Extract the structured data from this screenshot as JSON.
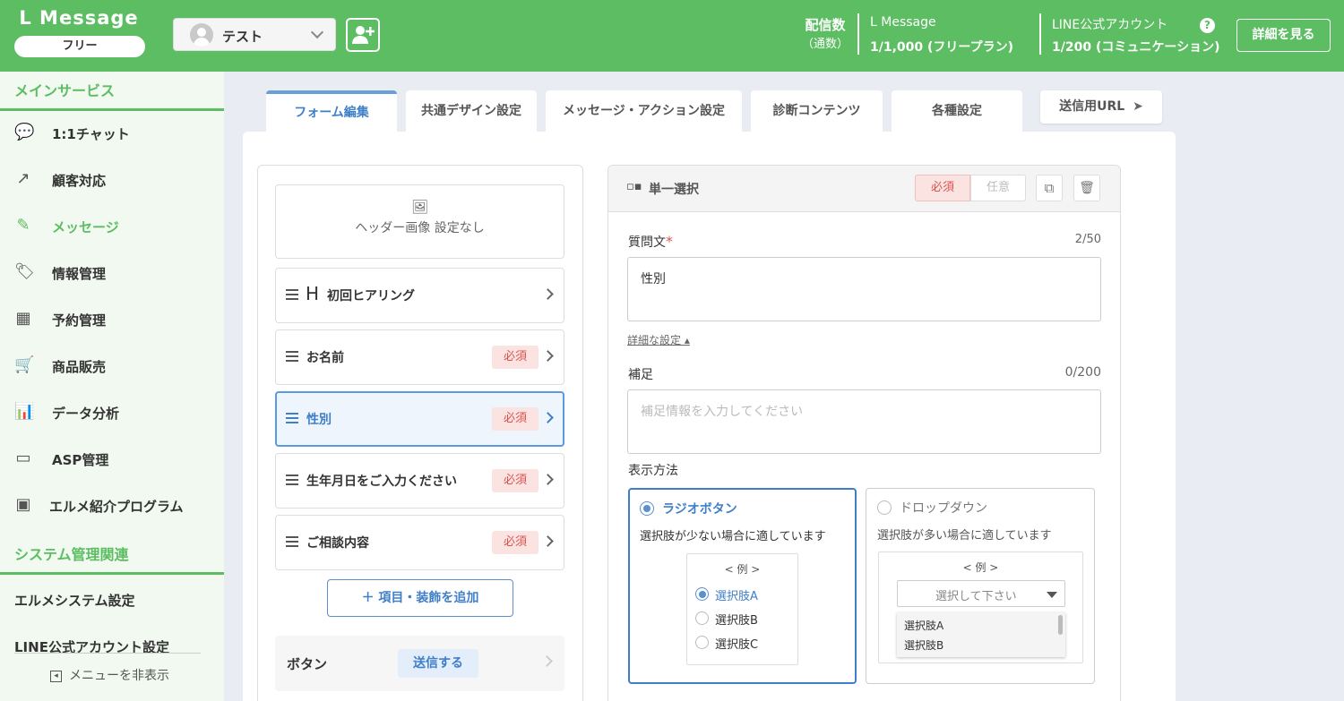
{
  "topbar": {
    "brand": "L Message",
    "plan_pill": "フリー",
    "account_name": "テスト",
    "stat_label_line1": "配信数",
    "stat_label_line2": "（通数）",
    "lmessage_caption": "L Message",
    "lmessage_value": "1/1,000 (フリープラン)",
    "line_caption": "LINE公式アカウント",
    "line_value": "1/200 (コミュニケーション)",
    "help_icon_glyph": "?",
    "details_button": "詳細を見る"
  },
  "sidebar": {
    "main_section": "メインサービス",
    "items": [
      {
        "label": "1:1チャット",
        "icon": "chat-icon",
        "glyph": "💬"
      },
      {
        "label": "顧客対応",
        "icon": "arrow-up-right-icon",
        "glyph": "↗"
      },
      {
        "label": "メッセージ",
        "icon": "message-edit-icon",
        "glyph": "✎"
      },
      {
        "label": "情報管理",
        "icon": "tag-icon",
        "glyph": "🏷"
      },
      {
        "label": "予約管理",
        "icon": "calendar-icon",
        "glyph": "▦"
      },
      {
        "label": "商品販売",
        "icon": "cart-icon",
        "glyph": "🛒"
      },
      {
        "label": "データ分析",
        "icon": "bar-chart-icon",
        "glyph": "📊"
      },
      {
        "label": "ASP管理",
        "icon": "register-icon",
        "glyph": "▭"
      },
      {
        "label": "エルメ紹介プログラム",
        "icon": "id-badge-icon",
        "glyph": "▣"
      }
    ],
    "active_index": 2,
    "system_section": "システム管理関連",
    "system_items": [
      "エルメシステム設定",
      "LINE公式アカウント設定"
    ],
    "hide_menu": "メニューを非表示",
    "hide_menu_glyph": "◂"
  },
  "tabs": [
    "フォーム編集",
    "共通デザイン設定",
    "メッセージ・アクション設定",
    "診断コンテンツ",
    "各種設定"
  ],
  "url_button": "送信用URL",
  "url_button_glyph": "➤",
  "form_items": {
    "header_image_label": "ヘッダー画像 設定なし",
    "header_image_glyph": "🖼",
    "heading_glyph": "H",
    "rows": [
      {
        "label": "初回ヒアリング",
        "required": ""
      },
      {
        "label": "お名前",
        "required": "必須"
      },
      {
        "label": "性別",
        "required": "必須"
      },
      {
        "label": "生年月日をご入力ください",
        "required": "必須"
      },
      {
        "label": "ご相談内容",
        "required": "必須"
      }
    ],
    "add_button": "＋ 項目・装飾を追加",
    "button_row_label": "ボタン",
    "submit_chip": "送信する"
  },
  "editor": {
    "type_icon_glyph": "▫▪",
    "type_label": "単一選択",
    "required_toggle": "必須",
    "optional_toggle": "任意",
    "copy_glyph": "⧉",
    "trash_glyph": "🗑",
    "question_label": "質問文",
    "question_required_mark": "*",
    "question_counter": "2/50",
    "question_value": "性別",
    "advanced_link": "詳細な設定",
    "advanced_caret": "▴",
    "supplement_label": "補足",
    "supplement_counter": "0/200",
    "supplement_placeholder": "補足情報を入力してください",
    "display_label": "表示方法",
    "radio_option": {
      "title": "ラジオボタン",
      "desc": "選択肢が少ない場合に適しています",
      "example": "< 例 >",
      "choices": [
        "選択肢A",
        "選択肢B",
        "選択肢C"
      ]
    },
    "dropdown_option": {
      "title": "ドロップダウン",
      "desc": "選択肢が多い場合に適しています",
      "example": "< 例 >",
      "select_placeholder": "選択して下さい",
      "choices": [
        "選択肢A",
        "選択肢B"
      ]
    }
  }
}
